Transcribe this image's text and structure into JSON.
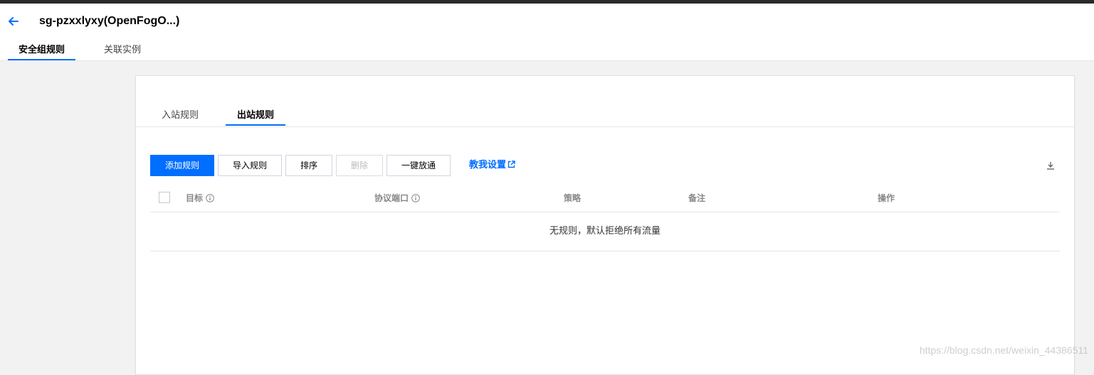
{
  "header": {
    "title": "sg-pzxxlyxy(OpenFogO...)",
    "tabs": [
      {
        "label": "安全组规则",
        "active": true
      },
      {
        "label": "关联实例",
        "active": false
      }
    ]
  },
  "rules_panel": {
    "tabs": [
      {
        "label": "入站规则",
        "active": false
      },
      {
        "label": "出站规则",
        "active": true
      }
    ],
    "toolbar": {
      "add_rule": "添加规则",
      "import_rules": "导入规则",
      "sort": "排序",
      "delete": "删除",
      "allow_all": "一键放通",
      "help_link": "教我设置"
    },
    "table": {
      "columns": [
        "目标",
        "协议端口",
        "策略",
        "备注",
        "操作"
      ],
      "empty_message": "无规则，默认拒绝所有流量"
    }
  },
  "watermark": "https://blog.csdn.net/weixin_44386511",
  "colors": {
    "accent": "#006eff",
    "top_bar": "#2a2a2a",
    "background": "#f2f2f2"
  },
  "icons": [
    "arrow-left-icon",
    "external-link-icon",
    "download-icon",
    "info-icon"
  ]
}
